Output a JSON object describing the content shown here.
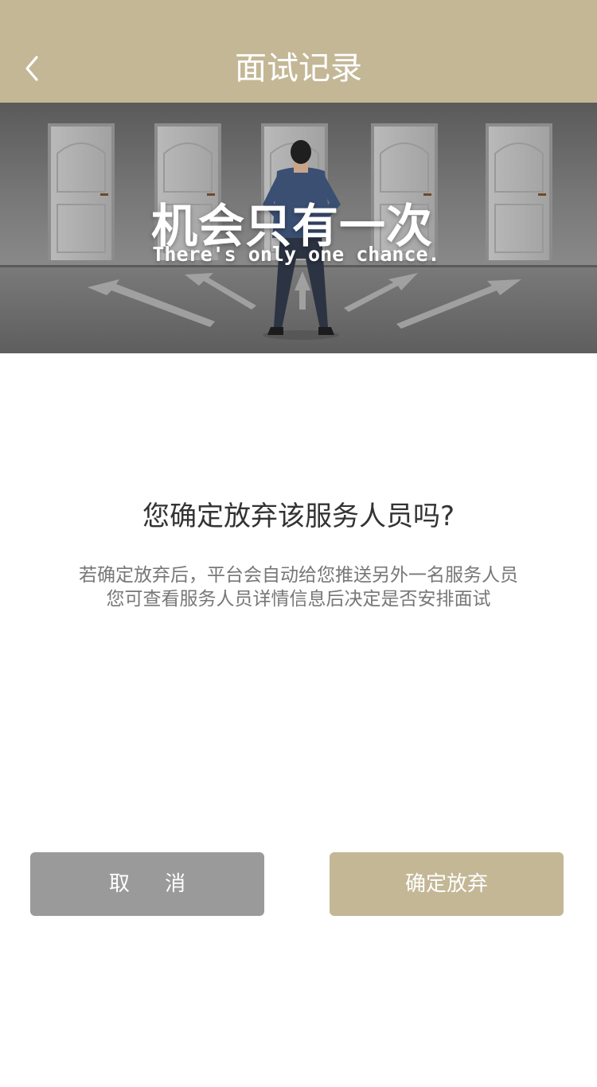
{
  "header": {
    "title": "面试记录",
    "back_icon": "chevron-left-icon",
    "background_color": "#c4b796"
  },
  "banner": {
    "title": "机会只有一次",
    "subtitle": "There's only one chance."
  },
  "dialog": {
    "question": "您确定放弃该服务人员吗?",
    "description_lines": [
      "若确定放弃后，平台会自动给您推送另外一名服务人员",
      "您可查看服务人员详情信息后决定是否安排面试"
    ]
  },
  "buttons": {
    "cancel_label": "取 消",
    "cancel_color": "#9a9a9a",
    "confirm_label": "确定放弃",
    "confirm_color": "#c4b796"
  }
}
